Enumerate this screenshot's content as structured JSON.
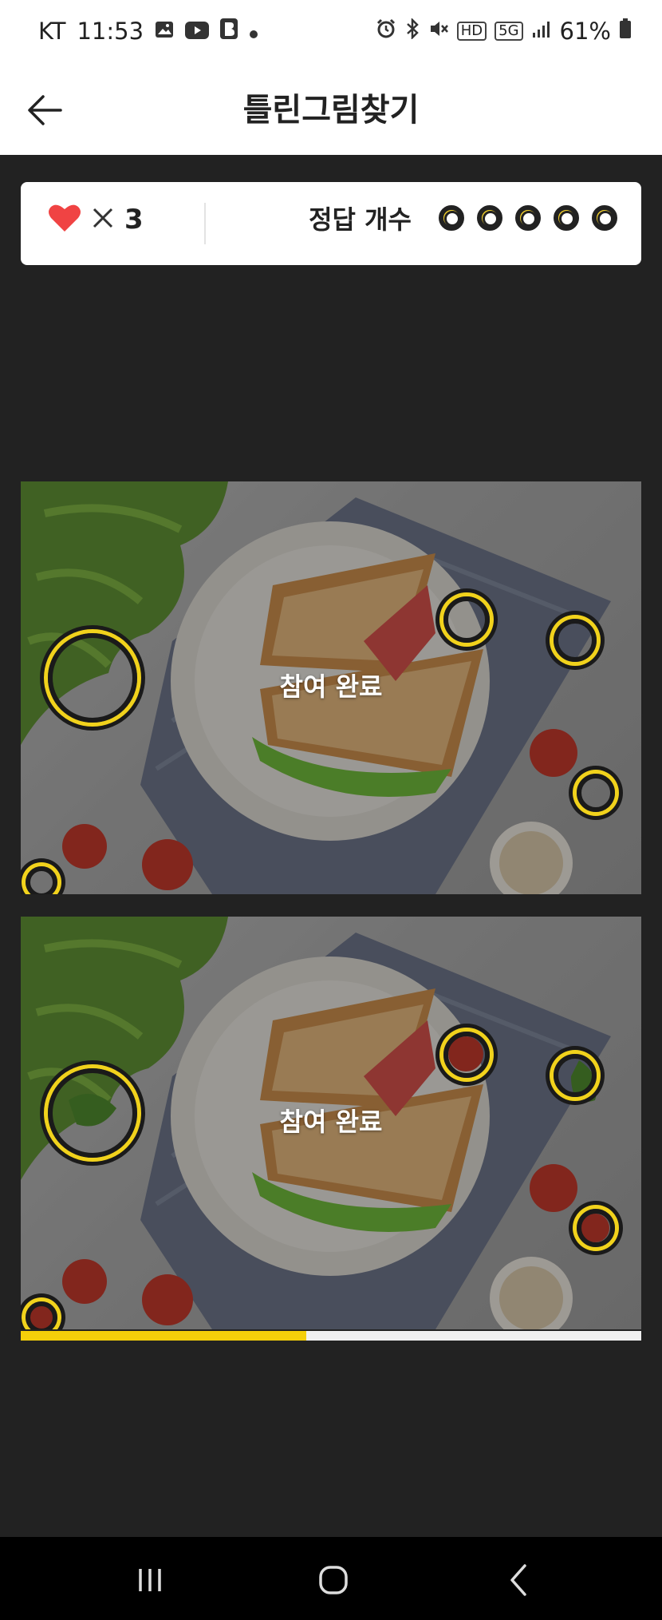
{
  "status_bar": {
    "carrier": "KT",
    "time": "11:53",
    "battery": "61%",
    "hd_label": "HD",
    "net_label": "5G",
    "left_icons": [
      "gallery-icon",
      "youtube-icon",
      "b-app-icon",
      "dot-icon"
    ],
    "right_icons": [
      "alarm-icon",
      "bluetooth-icon",
      "mute-icon",
      "hd-icon",
      "5g-icon",
      "signal-icon",
      "battery-icon"
    ]
  },
  "header": {
    "title": "틀린그림찾기",
    "back_icon": "back-arrow-icon"
  },
  "score": {
    "lives": "3",
    "lives_prefix": "✕",
    "answers_label": "정답 개수",
    "answers_total": 5,
    "answers_found": 0
  },
  "game": {
    "top_overlay_text": "참여 완료",
    "bottom_overlay_text": "참여 완료",
    "progress": 0.46,
    "colors": {
      "accent": "#f4cf0a",
      "heart": "#f04343",
      "background": "#222222"
    }
  },
  "nav": {
    "icons": [
      "recent-apps-icon",
      "home-icon",
      "back-icon"
    ]
  }
}
